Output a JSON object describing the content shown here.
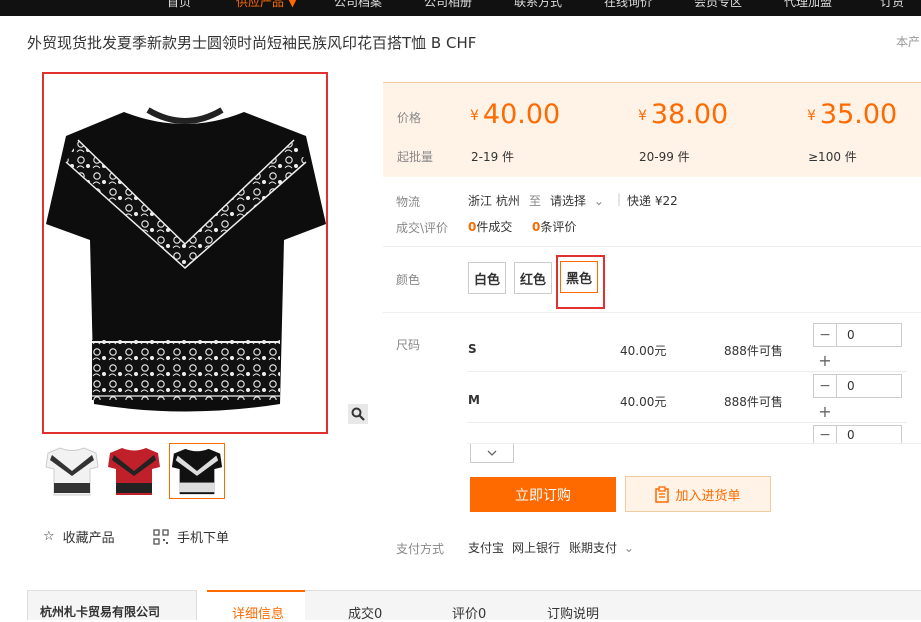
{
  "nav": {
    "items": [
      {
        "label": "首页"
      },
      {
        "label": "供应产品 ▼"
      },
      {
        "label": "公司档案"
      },
      {
        "label": "公司相册"
      },
      {
        "label": "联系方式"
      },
      {
        "label": "在线询价"
      },
      {
        "label": "会员专区"
      },
      {
        "label": "代理加盟"
      },
      {
        "label": "订货"
      }
    ]
  },
  "product": {
    "title": "外贸现货批发夏季新款男士圆领时尚短袖民族风印花百搭T恤 B CHF",
    "top_right": "本产"
  },
  "pricing": {
    "price_label": "价格",
    "qty_label": "起批量",
    "currency": "¥",
    "tiers": [
      {
        "price": "40.00",
        "qty": "2-19 件"
      },
      {
        "price": "38.00",
        "qty": "20-99 件"
      },
      {
        "price": "35.00",
        "qty": "≥100 件"
      }
    ]
  },
  "logistics": {
    "label": "物流",
    "from": "浙江 杭州",
    "to_word": "至",
    "select": "请选择",
    "express": "快递 ¥22"
  },
  "deals": {
    "label": "成交\\评价",
    "deals_count": "0",
    "deals_suffix": "件成交",
    "reviews_count": "0",
    "reviews_suffix": "条评价"
  },
  "colors": {
    "label": "颜色",
    "options": [
      "白色",
      "红色",
      "黑色"
    ],
    "selected": "黑色"
  },
  "sizes": {
    "label": "尺码",
    "rows": [
      {
        "name": "S",
        "price": "40.00元",
        "stock": "888件可售",
        "qty": "0"
      },
      {
        "name": "M",
        "price": "40.00元",
        "stock": "888件可售",
        "qty": "0"
      },
      {
        "name": "",
        "price": "",
        "stock": "",
        "qty": "0"
      }
    ]
  },
  "actions": {
    "buy": "立即订购",
    "add_to_cart": "加入进货单",
    "favorite": "收藏产品",
    "mobile_order": "手机下单"
  },
  "payment": {
    "label": "支付方式",
    "methods": [
      "支付宝",
      "网上银行",
      "账期支付"
    ]
  },
  "company": {
    "name": "杭州札卡贸易有限公司"
  },
  "tabs": [
    "详细信息",
    "成交0",
    "评价0",
    "订购说明"
  ],
  "colors_theme": {
    "accent": "#ff6a00",
    "highlight_box": "#e03030",
    "price_bg": "#fff3e8"
  }
}
